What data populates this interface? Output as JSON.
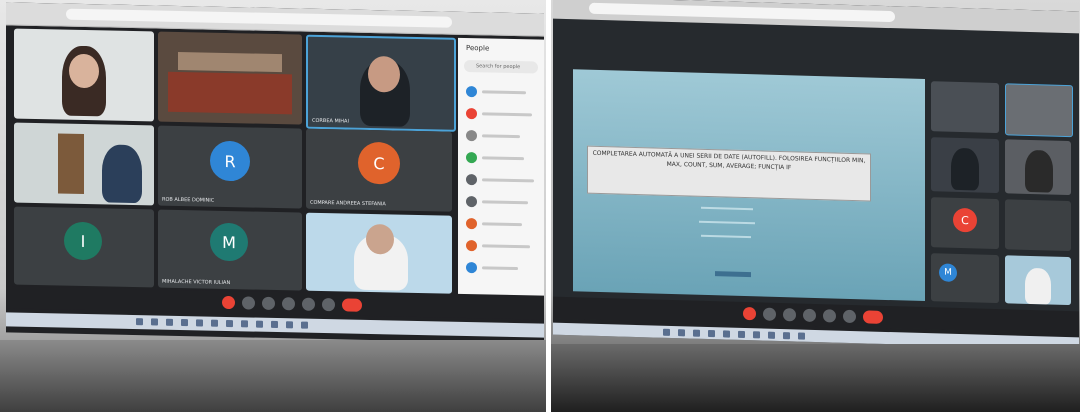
{
  "left_photo": {
    "panel_title": "People",
    "search_placeholder": "Search for people",
    "participants": [
      {
        "name": "ROB ALBEE DOMINIC",
        "initial": "R",
        "color": "#2f86d6"
      },
      {
        "name": "COMPARE ANDREEA STEFANIA",
        "initial": "C",
        "color": "#e0632c"
      },
      {
        "name": "",
        "initial": "I",
        "color": "#1f7a62"
      },
      {
        "name": "MIHALACHE VICTOR IULIAN",
        "initial": "M",
        "color": "#1f7a72"
      },
      {
        "name": "CORBEA MIHAI",
        "initial": "",
        "color": "#3c4043"
      }
    ],
    "panel_dot_colors": [
      "#2f86d6",
      "#ea4335",
      "#888888",
      "#34a853",
      "#5f6368",
      "#5f6368",
      "#e0632c",
      "#e0632c",
      "#2f86d6"
    ],
    "clock_hint": "...",
    "taskbar_hint": ""
  },
  "right_photo": {
    "slide_text": "COMPLETAREA AUTOMATĂ A UNEI SERII DE DATE (AUTOFILL). FOLOSIREA FUNCȚIILOR MIN, MAX, COUNT, SUM, AVERAGE; FUNCȚIA IF",
    "side_tile_avatar": {
      "initial": "C",
      "color": "#ea4335"
    },
    "small_tile_avatar": {
      "initial": "M",
      "color": "#2f86d6"
    }
  }
}
